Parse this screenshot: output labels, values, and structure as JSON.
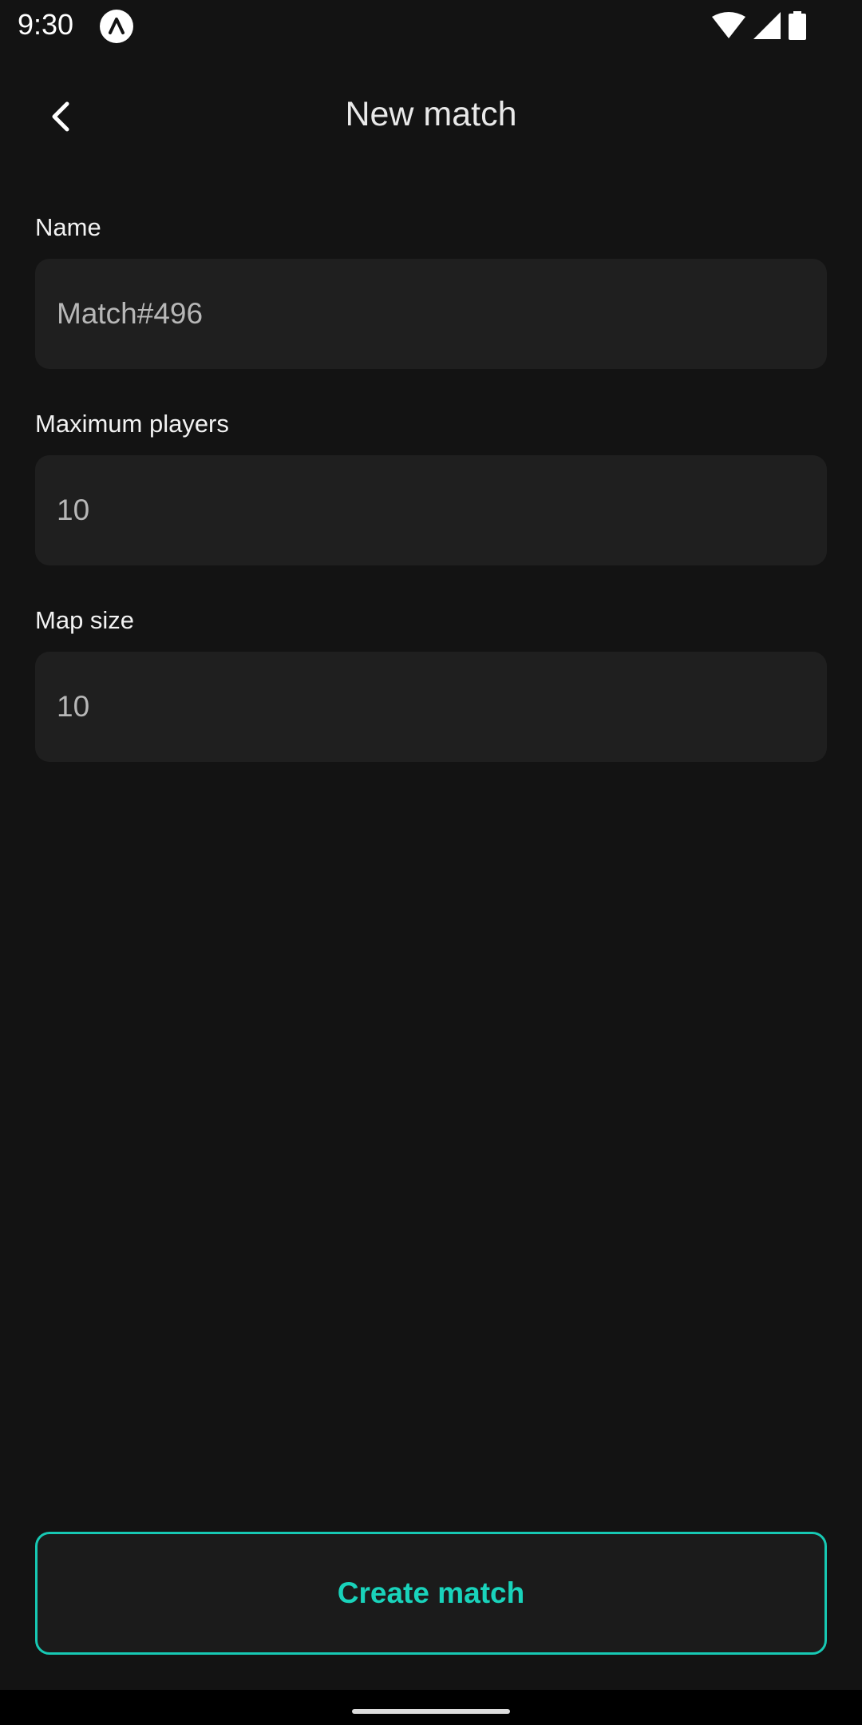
{
  "status_bar": {
    "time": "9:30",
    "icons": [
      "app-notification-icon",
      "wifi-icon",
      "cellular-signal-icon",
      "battery-icon"
    ]
  },
  "app_bar": {
    "title": "New match",
    "back_icon": "chevron-left-icon"
  },
  "form": {
    "name": {
      "label": "Name",
      "value": "Match#496"
    },
    "max_players": {
      "label": "Maximum players",
      "value": "10"
    },
    "map_size": {
      "label": "Map size",
      "value": "10"
    }
  },
  "actions": {
    "create_label": "Create match"
  },
  "colors": {
    "background": "#131313",
    "field_background": "#1f1f1f",
    "accent": "#19d3bb",
    "text_primary": "#ffffff",
    "text_value": "#b7b7b7"
  }
}
